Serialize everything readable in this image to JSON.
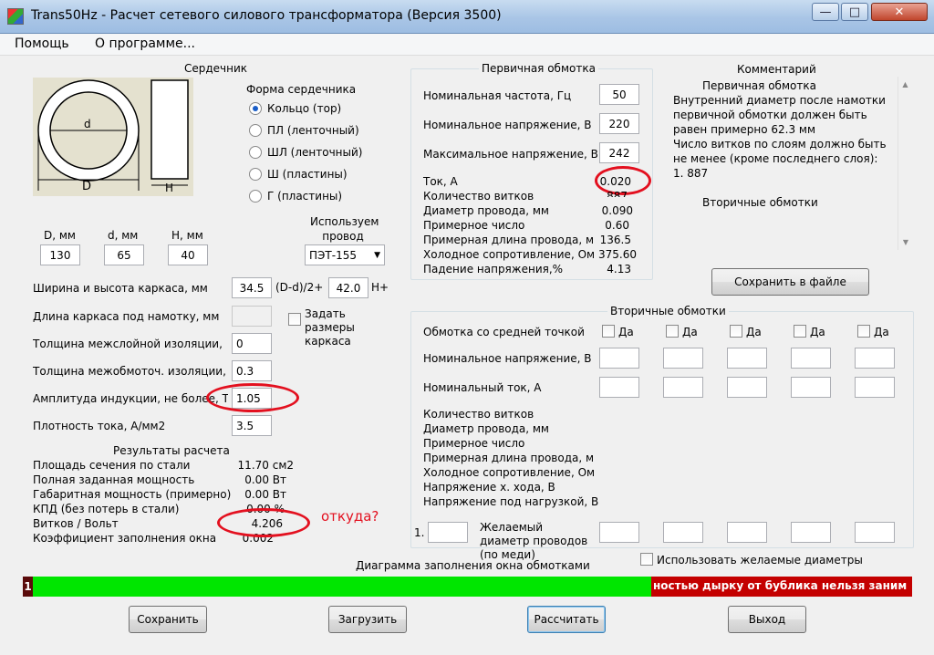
{
  "window": {
    "title": "Trans50Hz - Расчет сетевого силового трансформатора (Версия 3500)",
    "min": "—",
    "max": "□",
    "close": "✕"
  },
  "menu": {
    "help": "Помощь",
    "about": "О программе..."
  },
  "core": {
    "title": "Сердечник",
    "shape_title": "Форма сердечника",
    "shapes": [
      "Кольцо  (тор)",
      "ПЛ  (ленточный)",
      "ШЛ  (ленточный)",
      "Ш   (пластины)",
      "Г  (пластины)"
    ],
    "selected": "Кольцо  (тор)",
    "fig_d": "d",
    "fig_D": "D",
    "fig_H": "H",
    "D_label": "D, мм",
    "d_label": "d, мм",
    "H_label": "H, мм",
    "D_value": "130",
    "d_value": "65",
    "H_value": "40",
    "wire_title": "Используем провод",
    "wire_value": "ПЭТ-155"
  },
  "params": {
    "frame_wh_label": "Ширина и высота каркаса, мм",
    "frame_w": "34.5",
    "frame_w_hint": "(D-d)/2+",
    "frame_h": "42.0",
    "frame_h_hint": "H+",
    "frame_len_label": "Длина каркаса под намотку, мм",
    "frame_len": "",
    "set_frame_label": "Задать размеры каркаса",
    "layer_ins_label": "Толщина межслойной изоляции, мм",
    "layer_ins": "0",
    "winding_ins_label": "Толщина межобмоточ. изоляции, мм",
    "winding_ins": "0.3",
    "induction_label": "Амплитуда индукции, не более, Тл",
    "induction": "1.05",
    "current_density_label": "Плотность тока, А/мм2",
    "current_density": "3.5"
  },
  "results": {
    "title": "Результаты расчета",
    "rows": [
      {
        "label": "Площадь сечения по стали",
        "value": "11.70 см2"
      },
      {
        "label": "Полная заданная мощность",
        "value": "0.00 Вт"
      },
      {
        "label": "Габаритная мощность (примерно)",
        "value": "0.00 Вт"
      },
      {
        "label": "КПД (без потерь в стали)",
        "value": "0.00 %"
      },
      {
        "label": "Витков / Вольт",
        "value": "4.206"
      },
      {
        "label": "Коэффициент заполнения окна",
        "value": "0.002"
      }
    ],
    "annotation": "откуда?"
  },
  "primary": {
    "title": "Первичная обмотка",
    "freq_label": "Номинальная частота, Гц",
    "freq": "50",
    "volt_label": "Номинальное напряжение, В",
    "volt": "220",
    "maxvolt_label": "Максимальное напряжение, В",
    "maxvolt": "242",
    "rows": [
      {
        "label": "Ток, А",
        "value": "0.020"
      },
      {
        "label": "Количество витков",
        "value": "887"
      },
      {
        "label": "Диаметр провода, мм",
        "value": "0.090"
      },
      {
        "label": "Примерное число",
        "value": "0.60"
      },
      {
        "label": "Примерная длина провода, м",
        "value": "136.5"
      },
      {
        "label": "Холодное сопротивление, Ом",
        "value": "375.60"
      },
      {
        "label": "Падение напряжения,%",
        "value": "4.13"
      }
    ]
  },
  "comment": {
    "title": "Комментарий",
    "heading": "Первичная обмотка",
    "text": "Внутренний диаметр после намотки первичной обмотки должен быть равен примерно 62.3 мм\nЧисло витков по слоям должно быть не менее (кроме последнего слоя):\n1. 887",
    "secondary": "Вторичные обмотки",
    "save_button": "Сохранить в файле"
  },
  "secondary": {
    "title": "Вторичные обмотки",
    "center_tap_label": "Обмотка со средней точкой",
    "yes": "Да",
    "volt_label": "Номинальное напряжение, В",
    "current_label": "Номинальный ток, А",
    "info_rows": [
      "Количество витков",
      "Диаметр провода, мм",
      "Примерное число",
      "Примерная длина провода, м",
      "Холодное сопротивление, Ом",
      "Напряжение х. хода, В",
      "Напряжение под нагрузкой, В"
    ],
    "desired_index": "1.",
    "desired_label": "Желаемый диаметр проводов  (по меди)",
    "use_desired_label": "Использовать желаемые диаметры"
  },
  "diagram": {
    "title": "Диаграмма заполнения окна обмотками",
    "marker": "1",
    "fill_fraction": 0.703,
    "message": "ностью дырку от бублика нельзя заним"
  },
  "buttons": {
    "save": "Сохранить",
    "load": "Загрузить",
    "calc": "Рассчитать",
    "exit": "Выход"
  },
  "colors": {
    "fill": "#00e600",
    "message_bg": "#c40000",
    "annotation": "#e3101f"
  }
}
